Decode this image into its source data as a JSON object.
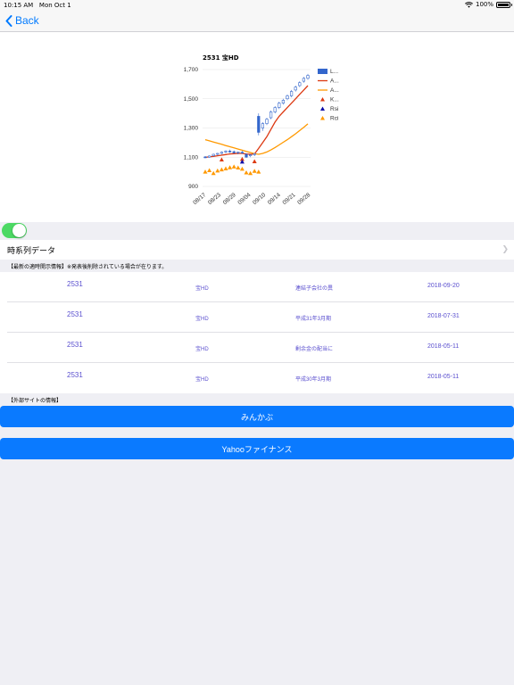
{
  "status_bar": {
    "time": "10:15 AM",
    "date": "Mon Oct 1",
    "battery": "100%",
    "battery_level": 1.0
  },
  "nav": {
    "back_label": "Back"
  },
  "chart_data": {
    "type": "candlestick",
    "title": "2531 宝HD",
    "ylim": [
      900,
      1700
    ],
    "yticks": [
      "900",
      "1,100",
      "1,300",
      "1,500",
      "1,700"
    ],
    "xticks": [
      "08/17",
      "08/23",
      "08/29",
      "09/04",
      "09/10",
      "09/14",
      "09/21",
      "09/28"
    ],
    "grid": true,
    "legend": [
      "L...",
      "A...",
      "A...",
      "K...",
      "Rsi",
      "Rci"
    ],
    "legend_position": "right",
    "series_colors": {
      "candle": "#3366cc",
      "ma_short": "#dc3912",
      "ma_long": "#ff9900",
      "signal_k": "#dc3912",
      "signal_rsi": "#0a0aa8",
      "signal_rci": "#ff9900"
    },
    "candles": [
      {
        "o": 1102,
        "h": 1108,
        "l": 1094,
        "c": 1100
      },
      {
        "o": 1100,
        "h": 1112,
        "l": 1096,
        "c": 1108
      },
      {
        "o": 1110,
        "h": 1124,
        "l": 1104,
        "c": 1120
      },
      {
        "o": 1120,
        "h": 1130,
        "l": 1112,
        "c": 1126
      },
      {
        "o": 1126,
        "h": 1140,
        "l": 1120,
        "c": 1134
      },
      {
        "o": 1136,
        "h": 1148,
        "l": 1128,
        "c": 1142
      },
      {
        "o": 1142,
        "h": 1152,
        "l": 1130,
        "c": 1138
      },
      {
        "o": 1138,
        "h": 1146,
        "l": 1126,
        "c": 1130
      },
      {
        "o": 1130,
        "h": 1140,
        "l": 1120,
        "c": 1136
      },
      {
        "o": 1134,
        "h": 1144,
        "l": 1124,
        "c": 1128
      },
      {
        "o": 1120,
        "h": 1126,
        "l": 1095,
        "c": 1100
      },
      {
        "o": 1112,
        "h": 1120,
        "l": 1100,
        "c": 1116
      },
      {
        "o": 1118,
        "h": 1128,
        "l": 1108,
        "c": 1124
      },
      {
        "o": 1380,
        "h": 1400,
        "l": 1250,
        "c": 1270
      },
      {
        "o": 1300,
        "h": 1340,
        "l": 1280,
        "c": 1330
      },
      {
        "o": 1330,
        "h": 1370,
        "l": 1320,
        "c": 1360
      },
      {
        "o": 1370,
        "h": 1420,
        "l": 1360,
        "c": 1410
      },
      {
        "o": 1410,
        "h": 1450,
        "l": 1400,
        "c": 1440
      },
      {
        "o": 1440,
        "h": 1480,
        "l": 1430,
        "c": 1470
      },
      {
        "o": 1470,
        "h": 1500,
        "l": 1460,
        "c": 1490
      },
      {
        "o": 1500,
        "h": 1530,
        "l": 1490,
        "c": 1520
      },
      {
        "o": 1520,
        "h": 1560,
        "l": 1510,
        "c": 1550
      },
      {
        "o": 1560,
        "h": 1590,
        "l": 1550,
        "c": 1580
      },
      {
        "o": 1590,
        "h": 1620,
        "l": 1580,
        "c": 1610
      },
      {
        "o": 1620,
        "h": 1650,
        "l": 1610,
        "c": 1640
      },
      {
        "o": 1640,
        "h": 1670,
        "l": 1630,
        "c": 1660
      }
    ],
    "ma_short": [
      1100,
      1102,
      1106,
      1110,
      1114,
      1118,
      1122,
      1124,
      1126,
      1126,
      1122,
      1120,
      1122,
      1160,
      1200,
      1240,
      1290,
      1340,
      1380,
      1410,
      1440,
      1470,
      1500,
      1530,
      1560,
      1590
    ],
    "ma_long": [
      1220,
      1212,
      1204,
      1196,
      1188,
      1180,
      1172,
      1164,
      1156,
      1148,
      1140,
      1132,
      1124,
      1120,
      1126,
      1136,
      1150,
      1166,
      1184,
      1202,
      1220,
      1240,
      1260,
      1282,
      1304,
      1328
    ],
    "signals_k_idx": [
      4,
      9,
      12
    ],
    "signals_rsi_idx": [
      9
    ],
    "rci_values": [
      1000,
      1010,
      990,
      1008,
      1015,
      1022,
      1030,
      1035,
      1028,
      1020,
      995,
      990,
      1005,
      1000
    ]
  },
  "toggle": {
    "on": true,
    "color": "#4cd964"
  },
  "timeseries_row": {
    "label": "時系列データ"
  },
  "disclosure_section": {
    "header": "【最新の適時開示情報】※発表後削除されている場合が在ります。",
    "rows": [
      {
        "code": "2531",
        "name": "宝HD",
        "title": "連結子会社の異",
        "date": "2018-09-20"
      },
      {
        "code": "2531",
        "name": "宝HD",
        "title": "平成31年3月期",
        "date": "2018-07-31"
      },
      {
        "code": "2531",
        "name": "宝HD",
        "title": "剰余金の配当に",
        "date": "2018-05-11"
      },
      {
        "code": "2531",
        "name": "宝HD",
        "title": "平成30年3月期",
        "date": "2018-05-11"
      }
    ]
  },
  "external_section": {
    "header": "【外部サイトの情報】",
    "buttons": [
      "みんかぶ",
      "Yahooファイナンス"
    ]
  }
}
